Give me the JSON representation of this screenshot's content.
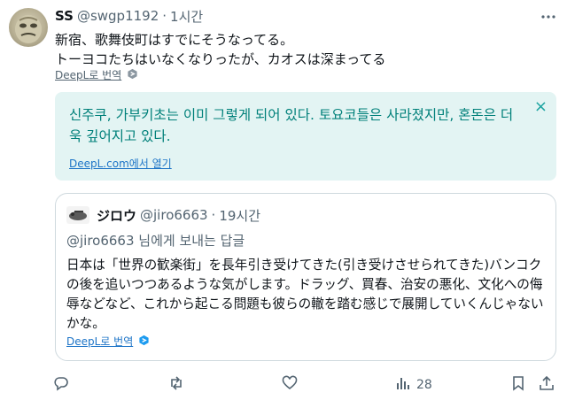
{
  "tweet": {
    "author_name": "SS",
    "author_handle": "@swgp1192",
    "separator": "·",
    "time": "1시간",
    "lines": [
      "新宿、歌舞伎町はすでにそうなってる。",
      "トーヨコたちはいなくなりったが、カオスは深まってる"
    ],
    "translate_label": "DeepL로 번역"
  },
  "translation": {
    "text": "신주쿠, 가부키초는 이미 그렇게 되어 있다. 토요코들은 사라졌지만, 혼돈은 더욱 깊어지고 있다.",
    "link": "DeepL.com에서 열기",
    "close": "×"
  },
  "quote": {
    "author_name": "ジロウ",
    "author_handle": "@jiro6663",
    "separator": "·",
    "time": "19시간",
    "reply_to": "@jiro6663 님에게 보내는 답글",
    "body": "日本は「世界の歓楽街」を長年引き受けてきた(引き受けさせられてきた)バンコクの後を追いつつあるような気がします。ドラッグ、買春、治安の悪化、文化への侮辱などなど、これから起こる問題も彼らの轍を踏む感じで展開していくんじゃないかな。",
    "translate_label": "DeepL로 번역"
  },
  "actions": {
    "views": "28"
  },
  "colors": {
    "text": "#0f1419",
    "muted": "#536471",
    "translation_bg": "#e3f4f3",
    "translation_text": "#00807a",
    "link": "#1d74c7",
    "border": "#cfd9de"
  },
  "icons": [
    "more-icon",
    "deepl-icon",
    "close-icon",
    "reply-icon",
    "retweet-icon",
    "like-icon",
    "views-icon",
    "bookmark-icon",
    "share-icon"
  ]
}
